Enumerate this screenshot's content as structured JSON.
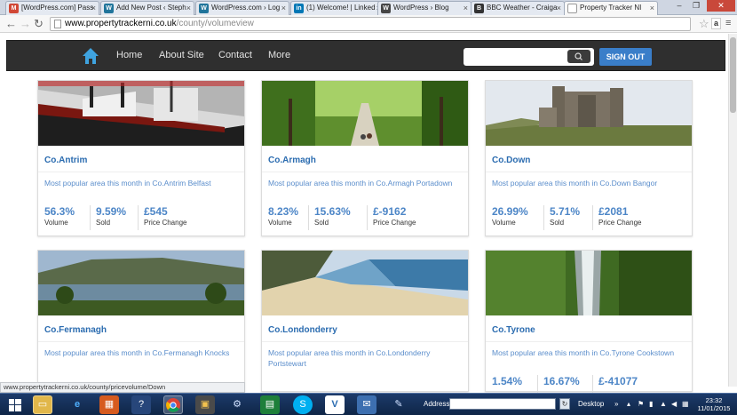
{
  "browser": {
    "tabs": [
      {
        "label": "[WordPress.com] Pass",
        "favicon": "gmail-icon",
        "color": "#d14836"
      },
      {
        "label": "Add New Post ‹ Steph",
        "favicon": "wordpress-icon",
        "color": "#21759b"
      },
      {
        "label": "WordPress.com › Log",
        "favicon": "wordpress-icon",
        "color": "#21759b"
      },
      {
        "label": "(1) Welcome! | Linked",
        "favicon": "linkedin-icon",
        "color": "#0077b5"
      },
      {
        "label": "WordPress › Blog",
        "favicon": "wordpress-icon",
        "color": "#464646"
      },
      {
        "label": "BBC Weather - Craiga",
        "favicon": "bbc-icon",
        "color": "#333333"
      },
      {
        "label": "Property Tracker NI",
        "favicon": "page-icon",
        "color": "#ffffff"
      }
    ],
    "url_host": "www.propertytrackerni.co.uk",
    "url_path": "/county/volumeview",
    "status_url": "www.propertytrackerni.co.uk/county/pricevolume/Down"
  },
  "nav": {
    "home": "Home",
    "about": "About Site",
    "contact": "Contact",
    "more": "More",
    "search_value": "",
    "signout": "SIGN OUT"
  },
  "counties": [
    {
      "name": "Co.Antrim",
      "popular": "Most popular area this month in Co.Antrim Belfast",
      "volume": "56.3%",
      "sold": "9.59%",
      "price": "£545",
      "volume_label": "Volume",
      "sold_label": "Sold",
      "price_label": "Price Change"
    },
    {
      "name": "Co.Armagh",
      "popular": "Most popular area this month in Co.Armagh Portadown",
      "volume": "8.23%",
      "sold": "15.63%",
      "price": "£-9162",
      "volume_label": "Volume",
      "sold_label": "Sold",
      "price_label": "Price Change"
    },
    {
      "name": "Co.Down",
      "popular": "Most popular area this month in Co.Down Bangor",
      "volume": "26.99%",
      "sold": "5.71%",
      "price": "£2081",
      "volume_label": "Volume",
      "sold_label": "Sold",
      "price_label": "Price Change"
    },
    {
      "name": "Co.Fermanagh",
      "popular": "Most popular area this month in Co.Fermanagh Knocks",
      "volume": "",
      "sold": "",
      "price": "",
      "volume_label": "",
      "sold_label": "",
      "price_label": ""
    },
    {
      "name": "Co.Londonderry",
      "popular": "Most popular area this month in Co.Londonderry Portstewart",
      "volume": "",
      "sold": "",
      "price": "",
      "volume_label": "",
      "sold_label": "",
      "price_label": ""
    },
    {
      "name": "Co.Tyrone",
      "popular": "Most popular area this month in Co.Tyrone Cookstown",
      "volume": "1.54%",
      "sold": "16.67%",
      "price": "£-41077",
      "volume_label": "",
      "sold_label": "",
      "price_label": ""
    }
  ],
  "taskbar": {
    "address_label": "Address",
    "desktop_label": "Desktop",
    "time": "23:32",
    "date": "11/01/2015"
  },
  "colors": {
    "accent": "#3a7ec9",
    "link": "#2b6cb0",
    "stat": "#4d86c7"
  }
}
